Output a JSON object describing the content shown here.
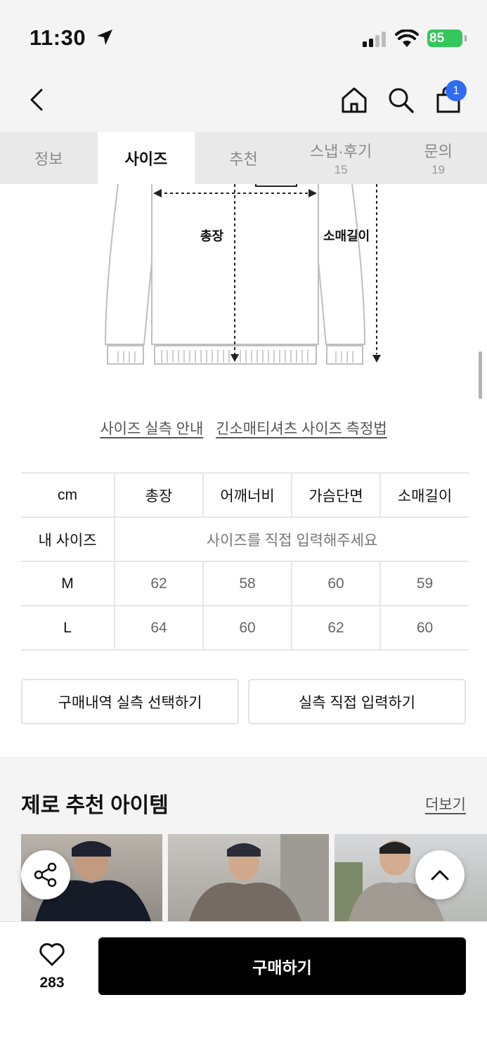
{
  "status_bar": {
    "time": "11:30",
    "battery": "85"
  },
  "nav": {
    "cart_count": "1"
  },
  "tabs": [
    {
      "label": "정보",
      "count": ""
    },
    {
      "label": "사이즈",
      "count": ""
    },
    {
      "label": "추천",
      "count": ""
    },
    {
      "label": "스냅·후기",
      "count": "15"
    },
    {
      "label": "문의",
      "count": "19"
    }
  ],
  "diagram": {
    "length_label": "총장",
    "sleeve_label": "소매길이"
  },
  "size_links": {
    "guide": "사이즈 실측 안내",
    "method": "긴소매티셔츠 사이즈 측정법"
  },
  "size_table": {
    "headers": [
      "cm",
      "총장",
      "어깨너비",
      "가슴단면",
      "소매길이"
    ],
    "my_size_label": "내 사이즈",
    "my_size_placeholder": "사이즈를 직접 입력해주세요",
    "rows": [
      {
        "size": "M",
        "values": [
          "62",
          "58",
          "60",
          "59"
        ]
      },
      {
        "size": "L",
        "values": [
          "64",
          "60",
          "62",
          "60"
        ]
      }
    ]
  },
  "actions": {
    "select_from_history": "구매내역 실측 선택하기",
    "enter_directly": "실측 직접 입력하기"
  },
  "recommend": {
    "title": "제로 추천 아이템",
    "more": "더보기"
  },
  "bottom": {
    "likes": "283",
    "buy": "구매하기"
  },
  "colors": {
    "accent_badge": "#2f6cf5",
    "battery": "#34c759",
    "buy_button": "#000000"
  }
}
